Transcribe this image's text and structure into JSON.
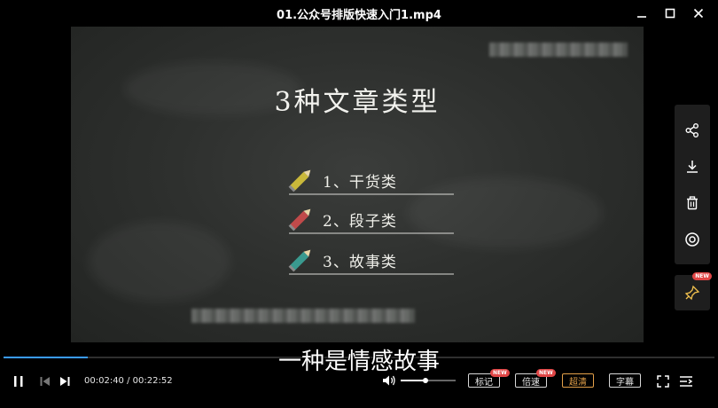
{
  "window": {
    "title": "01.公众号排版快速入门1.mp4",
    "controls": [
      "minimize",
      "maximize",
      "close"
    ]
  },
  "video": {
    "slide_title": "3种文章类型",
    "items": [
      {
        "label": "1、干货类",
        "pencil_color": "#c9b83a"
      },
      {
        "label": "2、段子类",
        "pencil_color": "#c04a4a"
      },
      {
        "label": "3、故事类",
        "pencil_color": "#3a9a8f"
      }
    ],
    "subtitle": "一种是情感故事"
  },
  "side_panel": {
    "icons": [
      "share-icon",
      "download-icon",
      "delete-icon",
      "target-icon"
    ],
    "pin_icon": "pin-icon",
    "pin_badge": "NEW"
  },
  "player": {
    "progress_fraction": 0.118,
    "current_time": "00:02:40",
    "total_time": "00:22:52",
    "time_separator": " / ",
    "volume_fraction": 0.45,
    "buttons": {
      "mark": "标记",
      "speed": "倍速",
      "quality": "超清",
      "subtitles": "字幕"
    },
    "badge": "NEW",
    "accent_color": "#3a9bff",
    "quality_color": "#e3a049"
  }
}
